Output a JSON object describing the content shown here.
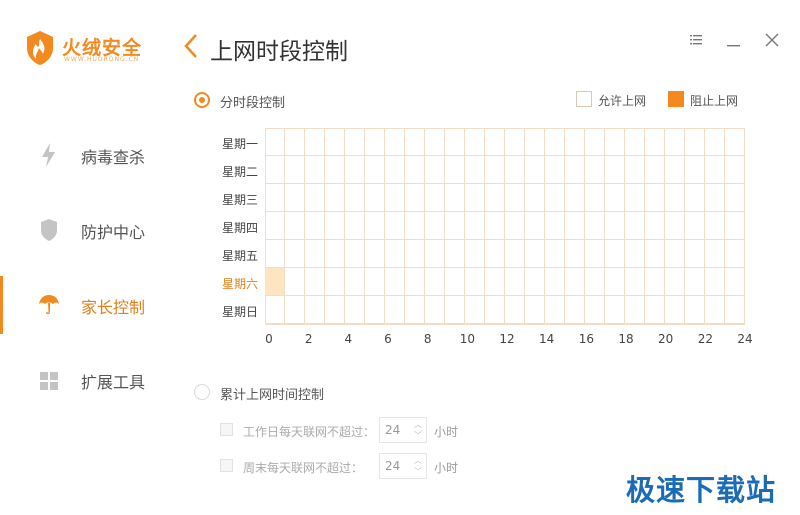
{
  "app": {
    "name": "火绒安全",
    "url": "WWW.HUORONG.CN"
  },
  "sidebar": {
    "items": [
      {
        "label": "病毒查杀",
        "icon": "lightning-icon",
        "active": false
      },
      {
        "label": "防护中心",
        "icon": "shield-icon",
        "active": false
      },
      {
        "label": "家长控制",
        "icon": "umbrella-icon",
        "active": true
      },
      {
        "label": "扩展工具",
        "icon": "grid-icon",
        "active": false
      }
    ]
  },
  "header": {
    "title": "上网时段控制"
  },
  "schedule": {
    "mode_label": "分时段控制",
    "selected": true,
    "legend": {
      "allow": "允许上网",
      "block": "阻止上网"
    },
    "days": [
      "星期一",
      "星期二",
      "星期三",
      "星期四",
      "星期五",
      "星期六",
      "星期日"
    ],
    "highlighted_day": 5,
    "hour_ticks": [
      "0",
      "2",
      "4",
      "6",
      "8",
      "10",
      "12",
      "14",
      "16",
      "18",
      "20",
      "22",
      "24"
    ],
    "blocked_slots": [
      {
        "day": 5,
        "hour": 0
      }
    ]
  },
  "cumulative": {
    "mode_label": "累计上网时间控制",
    "selected": false,
    "weekday": {
      "label": "工作日每天联网不超过：",
      "value": "24",
      "unit": "小时"
    },
    "weekend": {
      "label": "周末每天联网不超过：",
      "value": "24",
      "unit": "小时"
    }
  },
  "watermark": "极速下载站",
  "colors": {
    "accent": "#f28a1f",
    "blocked_cell": "#fde6bf",
    "grid_line": "#f1dcc6"
  }
}
